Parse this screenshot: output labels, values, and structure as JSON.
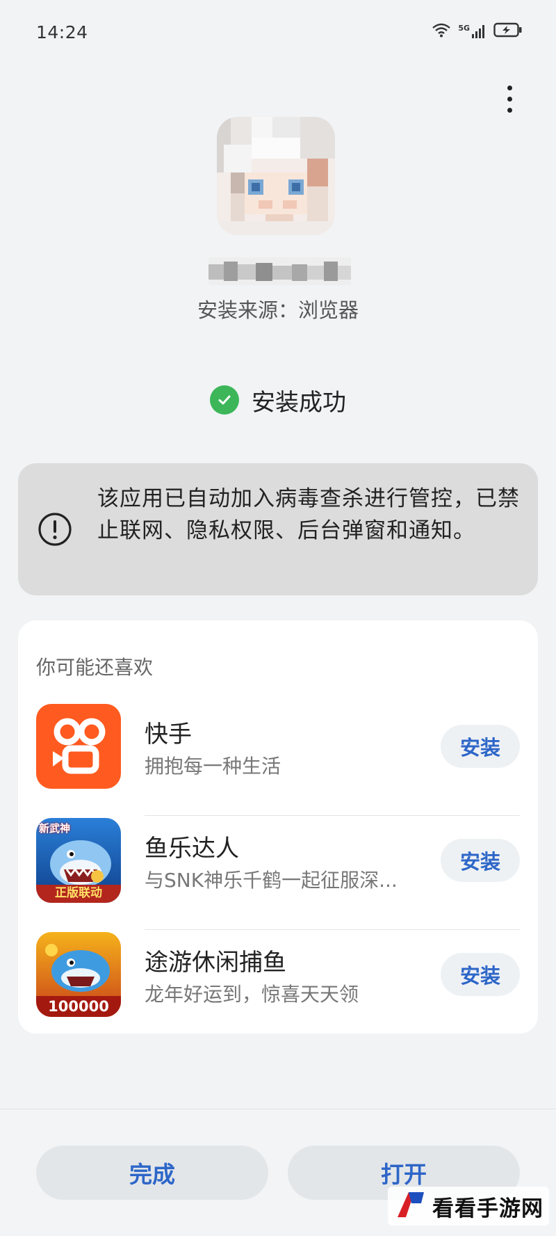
{
  "status_bar": {
    "time": "14:24",
    "network": "5G",
    "icons": [
      "wifi-icon",
      "signal-icon",
      "battery-charging-icon"
    ]
  },
  "header": {
    "more_icon": "more-vertical-icon"
  },
  "app": {
    "name_blurred": true,
    "install_source": "安装来源：浏览器"
  },
  "status": {
    "text": "安装成功",
    "icon": "check-circle-icon",
    "color": "#3cb659"
  },
  "warning": {
    "icon": "exclamation-circle-icon",
    "text": "该应用已自动加入病毒查杀进行管控，已禁止联网、隐私权限、后台弹窗和通知。"
  },
  "recommendations": {
    "title": "你可能还喜欢",
    "items": [
      {
        "name": "快手",
        "description": "拥抱每一种生活",
        "button": "安装",
        "icon": "kuaishou-icon"
      },
      {
        "name": "鱼乐达人",
        "description": "与SNK神乐千鹤一起征服深...",
        "button": "安装",
        "icon": "fish-game-icon",
        "badge_top": "新武神",
        "badge_bottom": "正版联动"
      },
      {
        "name": "途游休闲捕鱼",
        "description": "龙年好运到，惊喜天天领",
        "button": "安装",
        "icon": "fishing-game-icon",
        "badge_bottom": "100000"
      }
    ]
  },
  "actions": {
    "done": "完成",
    "open": "打开"
  },
  "watermark": {
    "text": "看看手游网"
  },
  "colors": {
    "accent": "#2d66c8",
    "kuaishou": "#ff5a1f",
    "success": "#3cb659"
  }
}
